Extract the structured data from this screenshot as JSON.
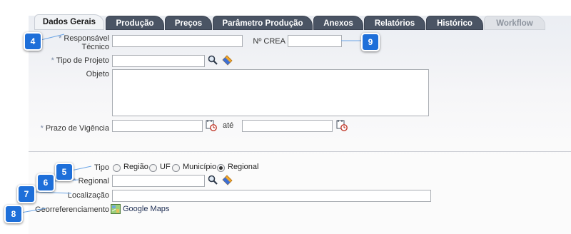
{
  "tabs": [
    {
      "label": "Dados Gerais",
      "state": "active"
    },
    {
      "label": "Produção",
      "state": "normal"
    },
    {
      "label": "Preços",
      "state": "normal"
    },
    {
      "label": "Parâmetro Produção",
      "state": "normal"
    },
    {
      "label": "Anexos",
      "state": "normal"
    },
    {
      "label": "Relatórios",
      "state": "normal"
    },
    {
      "label": "Histórico",
      "state": "normal"
    },
    {
      "label": "Workflow",
      "state": "disabled"
    }
  ],
  "form": {
    "required_marker": "*",
    "responsavel_tecnico": {
      "label_line1": "Responsável",
      "label_line2": "Técnico",
      "value": ""
    },
    "nr_crea": {
      "label": "Nº CREA",
      "value": ""
    },
    "tipo_projeto": {
      "label": "Tipo de Projeto",
      "value": ""
    },
    "objeto": {
      "label": "Objeto",
      "value": ""
    },
    "prazo_vigencia": {
      "label": "Prazo de Vigência",
      "from": "",
      "to": "",
      "separator": "até"
    },
    "tipo": {
      "label": "Tipo",
      "options": [
        "Região",
        "UF",
        "Município",
        "Regional"
      ],
      "selected": "Regional"
    },
    "regional": {
      "label": "Regional",
      "value": ""
    },
    "localizacao": {
      "label": "Localização",
      "value": ""
    },
    "georreferenciamento": {
      "label": "Georreferenciamento",
      "link": "Google Maps"
    }
  },
  "callouts": [
    "4",
    "9",
    "5",
    "6",
    "7",
    "8"
  ],
  "icons": {
    "search": "magnifier-icon",
    "clear": "eraser-icon",
    "calendar": "calendar-icon",
    "map": "map-icon"
  }
}
